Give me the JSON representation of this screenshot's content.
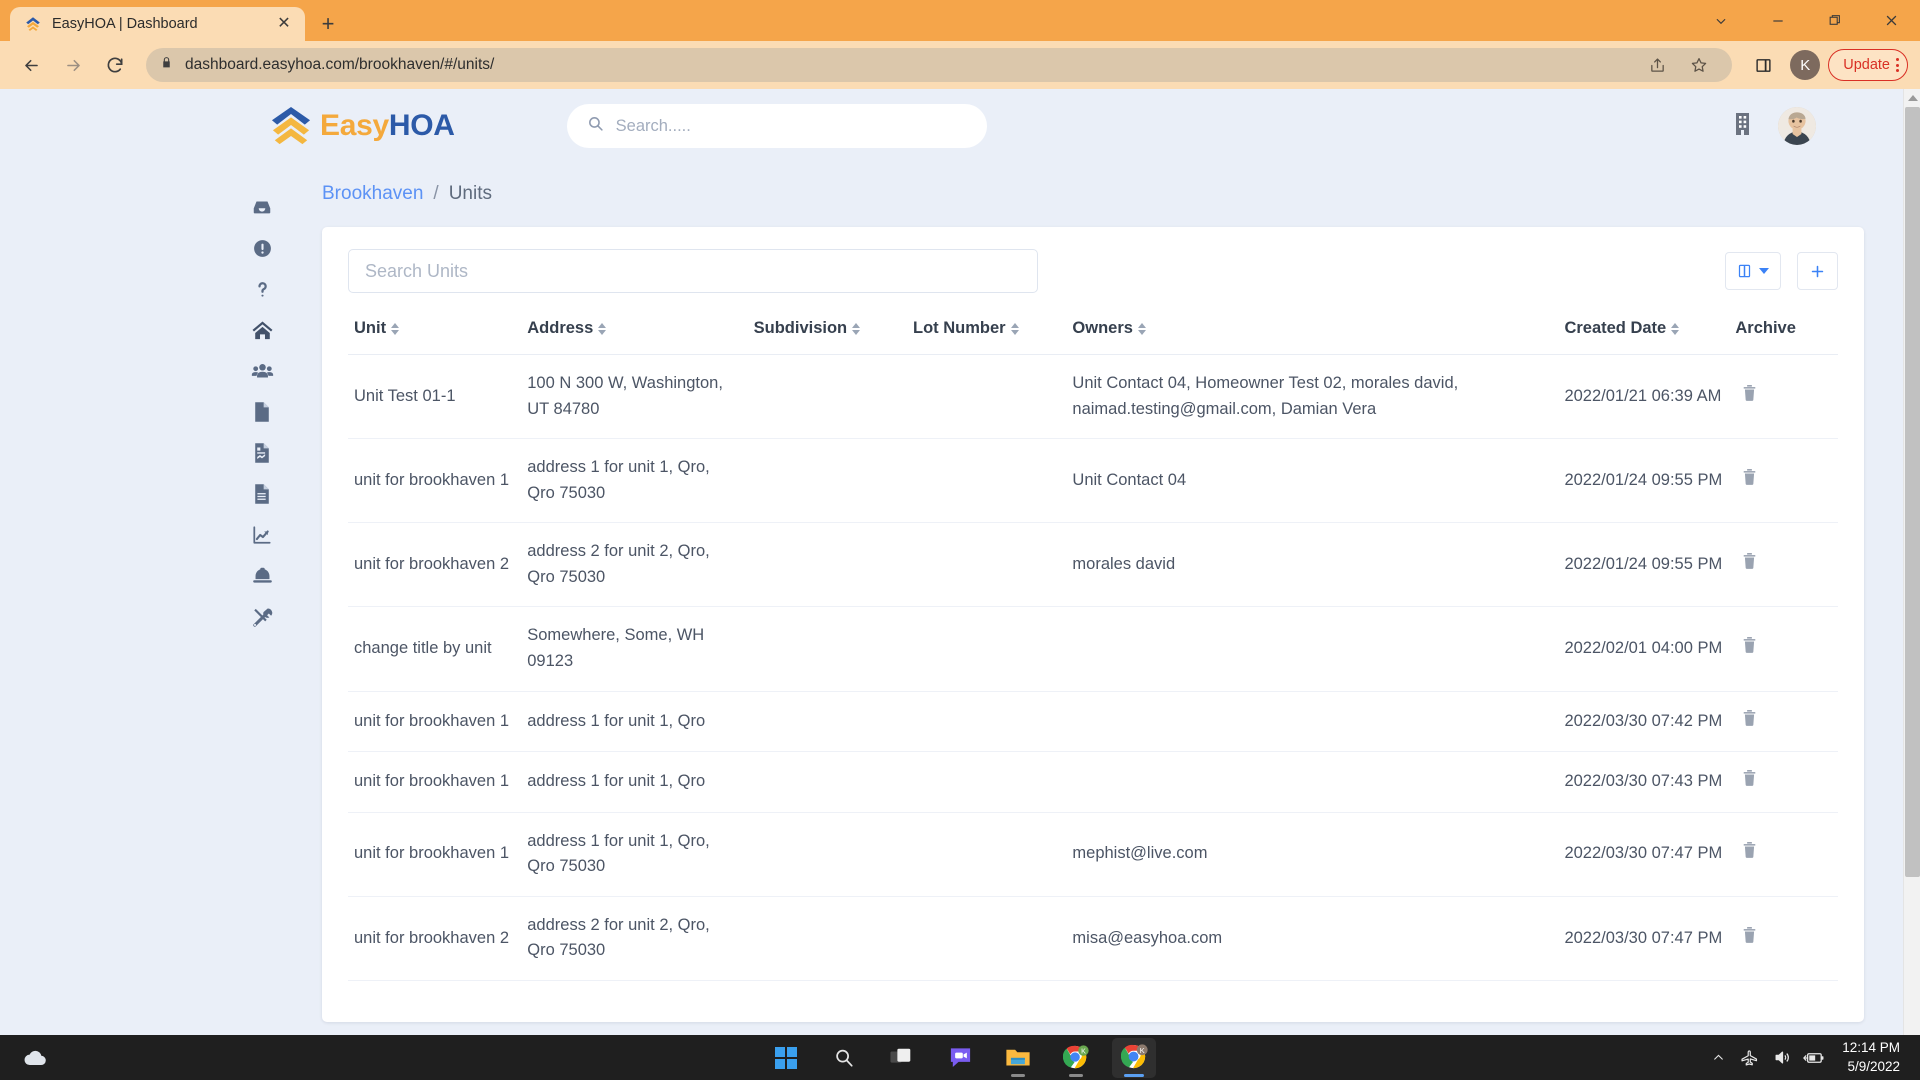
{
  "browser": {
    "tab": {
      "title": "EasyHOA | Dashboard",
      "favicon": "easyhoa-favicon",
      "close_label": "✕"
    },
    "new_tab_label": "+",
    "window_controls": {
      "minimize": "−",
      "maximize": "❐",
      "close": "✕",
      "chevron": "⌄"
    },
    "nav": {
      "back": "←",
      "forward": "→",
      "reload": "⟳"
    },
    "omnibox": {
      "lock_icon": "lock-icon",
      "url_domain": "dashboard.easyhoa.com",
      "url_path": "/brookhaven/#/units/",
      "full_url": "dashboard.easyhoa.com/brookhaven/#/units/"
    },
    "profile_initial": "K",
    "update_label": "Update"
  },
  "app": {
    "logo": {
      "easy": "Easy",
      "hoa": "HOA"
    },
    "search": {
      "placeholder": "Search.....",
      "value": ""
    },
    "header_icons": [
      "building-icon",
      "user-avatar"
    ]
  },
  "sidebar": {
    "items": [
      {
        "name": "inbox",
        "label": "Inbox"
      },
      {
        "name": "info",
        "label": "Information"
      },
      {
        "name": "help",
        "label": "Help"
      },
      {
        "name": "home",
        "label": "Home"
      },
      {
        "name": "residents",
        "label": "Residents"
      },
      {
        "name": "documents",
        "label": "Documents"
      },
      {
        "name": "reports",
        "label": "Reports"
      },
      {
        "name": "invoices",
        "label": "Invoices"
      },
      {
        "name": "analytics",
        "label": "Analytics"
      },
      {
        "name": "maintenance",
        "label": "Maintenance"
      },
      {
        "name": "tools",
        "label": "Tools"
      }
    ]
  },
  "breadcrumb": {
    "parent": "Brookhaven",
    "separator": "/",
    "current": "Units"
  },
  "units_panel": {
    "search": {
      "placeholder": "Search Units",
      "value": ""
    },
    "columns_button": "columns-toggle",
    "add_button": "+",
    "table": {
      "headers": [
        "Unit",
        "Address",
        "Subdivision",
        "Lot Number",
        "Owners",
        "Created Date",
        "Archive"
      ],
      "sortable": [
        true,
        true,
        true,
        true,
        true,
        true,
        false
      ],
      "rows": [
        {
          "unit": "Unit Test 01-1",
          "address": "100 N 300 W, Washington, UT 84780",
          "subdivision": "",
          "lot_number": "",
          "owners": "Unit Contact 04, Homeowner Test 02, morales david, naimad.testing@gmail.com, Damian Vera",
          "created_date": "2022/01/21 06:39 AM"
        },
        {
          "unit": "unit for brookhaven 1",
          "address": "address 1 for unit 1, Qro, Qro 75030",
          "subdivision": "",
          "lot_number": "",
          "owners": "Unit Contact 04",
          "created_date": "2022/01/24 09:55 PM"
        },
        {
          "unit": "unit for brookhaven 2",
          "address": "address 2 for unit 2, Qro, Qro 75030",
          "subdivision": "",
          "lot_number": "",
          "owners": "morales david",
          "created_date": "2022/01/24 09:55 PM"
        },
        {
          "unit": "change title by unit",
          "address": "Somewhere, Some, WH 09123",
          "subdivision": "",
          "lot_number": "",
          "owners": "",
          "created_date": "2022/02/01 04:00 PM"
        },
        {
          "unit": "unit for brookhaven 1",
          "address": "address 1 for unit 1, Qro",
          "subdivision": "",
          "lot_number": "",
          "owners": "",
          "created_date": "2022/03/30 07:42 PM"
        },
        {
          "unit": "unit for brookhaven 1",
          "address": "address 1 for unit 1, Qro",
          "subdivision": "",
          "lot_number": "",
          "owners": "",
          "created_date": "2022/03/30 07:43 PM"
        },
        {
          "unit": "unit for brookhaven 1",
          "address": "address 1 for unit 1, Qro, Qro 75030",
          "subdivision": "",
          "lot_number": "",
          "owners": "mephist@live.com",
          "created_date": "2022/03/30 07:47 PM"
        },
        {
          "unit": "unit for brookhaven 2",
          "address": "address 2 for unit 2, Qro, Qro 75030",
          "subdivision": "",
          "lot_number": "",
          "owners": "misa@easyhoa.com",
          "created_date": "2022/03/30 07:47 PM"
        }
      ],
      "archive_icon": "trash-icon"
    }
  },
  "taskbar": {
    "apps": [
      {
        "name": "start",
        "label": "Start"
      },
      {
        "name": "search",
        "label": "Search"
      },
      {
        "name": "task-view",
        "label": "Task View"
      },
      {
        "name": "chat",
        "label": "Chat"
      },
      {
        "name": "file-explorer",
        "label": "File Explorer"
      },
      {
        "name": "chrome-1",
        "label": "Google Chrome"
      },
      {
        "name": "chrome-2",
        "label": "Google Chrome"
      }
    ],
    "tray": {
      "chevron": "∧",
      "icons": [
        "airplane-mode-icon",
        "volume-icon",
        "battery-charging-icon"
      ],
      "time": "12:14 PM",
      "date": "5/9/2022"
    }
  },
  "colors": {
    "browser_accent": "#f5a54a",
    "brand_blue": "#2c5aa8",
    "brand_orange": "#f4a93c",
    "link_blue": "#5c92f5",
    "action_blue": "#3b82f6",
    "page_bg": "#eaeff8"
  }
}
